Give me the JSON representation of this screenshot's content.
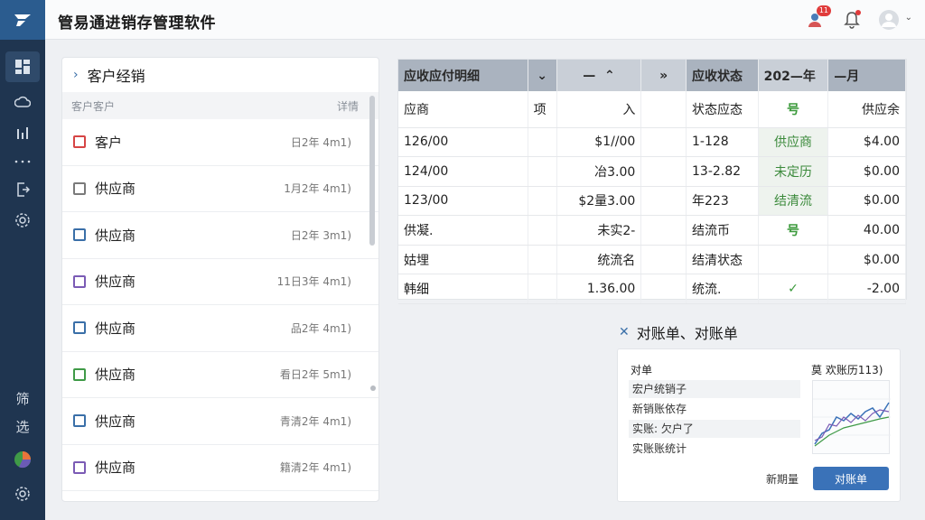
{
  "app": {
    "title": "管易通进销存管理软件",
    "notification_count": "11"
  },
  "rail": {
    "bottom_labels": [
      "筛",
      "选"
    ]
  },
  "list_panel": {
    "title": "客户经销",
    "col_left": "客户客户",
    "col_right": "详情",
    "items": [
      {
        "name": "客户",
        "date": "日2年 4m1)",
        "color": "#d64545"
      },
      {
        "name": "供应商",
        "date": "1月2年 4m1)",
        "color": "#7a7a7a"
      },
      {
        "name": "供应商",
        "date": "日2年 3m1)",
        "color": "#3a6fa8"
      },
      {
        "name": "供应商",
        "date": "11日3年 4m1)",
        "color": "#7b5bb5"
      },
      {
        "name": "供应商",
        "date": "品2年 4m1)",
        "color": "#3a6fa8"
      },
      {
        "name": "供应商",
        "date": "看日2年 5m1)",
        "color": "#3f9a47"
      },
      {
        "name": "供应商",
        "date": "青清2年 4m1)",
        "color": "#3a6fa8"
      },
      {
        "name": "供应商",
        "date": "籍清2年 4m1)",
        "color": "#7b5bb5"
      }
    ]
  },
  "table": {
    "headers": [
      "应收应付明细",
      "",
      "—",
      "",
      "应收状态",
      "202—年",
      "—月"
    ],
    "sub_headers": [
      "应商",
      "项",
      "入",
      "",
      "状态应态",
      "号",
      "供应余"
    ],
    "rows": [
      [
        "126/00",
        "",
        "$1//00",
        "",
        "1-128",
        "供应商",
        "$4.00"
      ],
      [
        "124/00",
        "",
        "冶3.00",
        "",
        "13-2.82",
        "未定历",
        "$0.00"
      ],
      [
        "123/00",
        "",
        "$2量3.00",
        "",
        "年223",
        "结清流",
        "$0.00"
      ],
      [
        "供凝.",
        "",
        "未实2-",
        "",
        "结流币",
        "号",
        "40.00"
      ],
      [
        "姑埋",
        "",
        "统流名",
        "",
        "结清状态",
        "",
        "$0.00"
      ],
      [
        "韩细",
        "",
        "1.36.00",
        "",
        "统流.",
        "✓",
        "-2.00"
      ]
    ]
  },
  "reconciliation": {
    "title": "对账单、对账单",
    "col_left": "对单",
    "col_right": "莫 欢账历113)",
    "rows": [
      "宏户统销子",
      "新销账依存",
      "实账: 欠户了",
      "实账账统计"
    ],
    "footer_label": "新期量",
    "button_label": "对账单"
  }
}
